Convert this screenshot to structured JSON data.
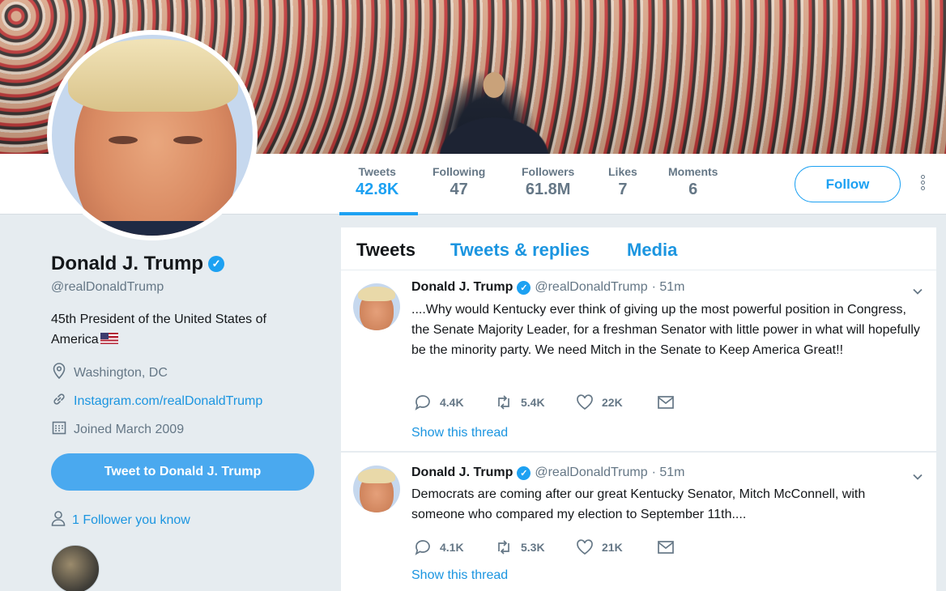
{
  "nav": {
    "stats": [
      {
        "label": "Tweets",
        "value": "42.8K"
      },
      {
        "label": "Following",
        "value": "47"
      },
      {
        "label": "Followers",
        "value": "61.8M"
      },
      {
        "label": "Likes",
        "value": "7"
      },
      {
        "label": "Moments",
        "value": "6"
      }
    ],
    "follow_label": "Follow"
  },
  "profile": {
    "name": "Donald J. Trump",
    "handle": "@realDonaldTrump",
    "bio": "45th President of the United States of America",
    "location": "Washington, DC",
    "website": "Instagram.com/realDonaldTrump",
    "joined": "Joined March 2009",
    "tweet_to_label": "Tweet to Donald J. Trump",
    "followers_you_know": "1 Follower you know"
  },
  "tabs": [
    "Tweets",
    "Tweets & replies",
    "Media"
  ],
  "tweets": [
    {
      "name": "Donald J. Trump",
      "handle": "@realDonaldTrump",
      "time": "· 51m",
      "text": "....Why would Kentucky ever think of giving up the most powerful position in Congress, the Senate Majority Leader, for a freshman Senator with little power in what will hopefully be the minority party. We need Mitch in the Senate to Keep America Great!!",
      "replies": "4.4K",
      "retweets": "5.4K",
      "likes": "22K",
      "thread_label": "Show this thread"
    },
    {
      "name": "Donald J. Trump",
      "handle": "@realDonaldTrump",
      "time": "· 51m",
      "text": "Democrats are coming after our great Kentucky Senator, Mitch McConnell, with someone who compared my election to September 11th....",
      "replies": "4.1K",
      "retweets": "5.3K",
      "likes": "21K",
      "thread_label": "Show this thread"
    }
  ],
  "colors": {
    "accent": "#1da1f2",
    "link": "#1b95e0",
    "muted": "#657786",
    "background": "#e6ecf0"
  }
}
